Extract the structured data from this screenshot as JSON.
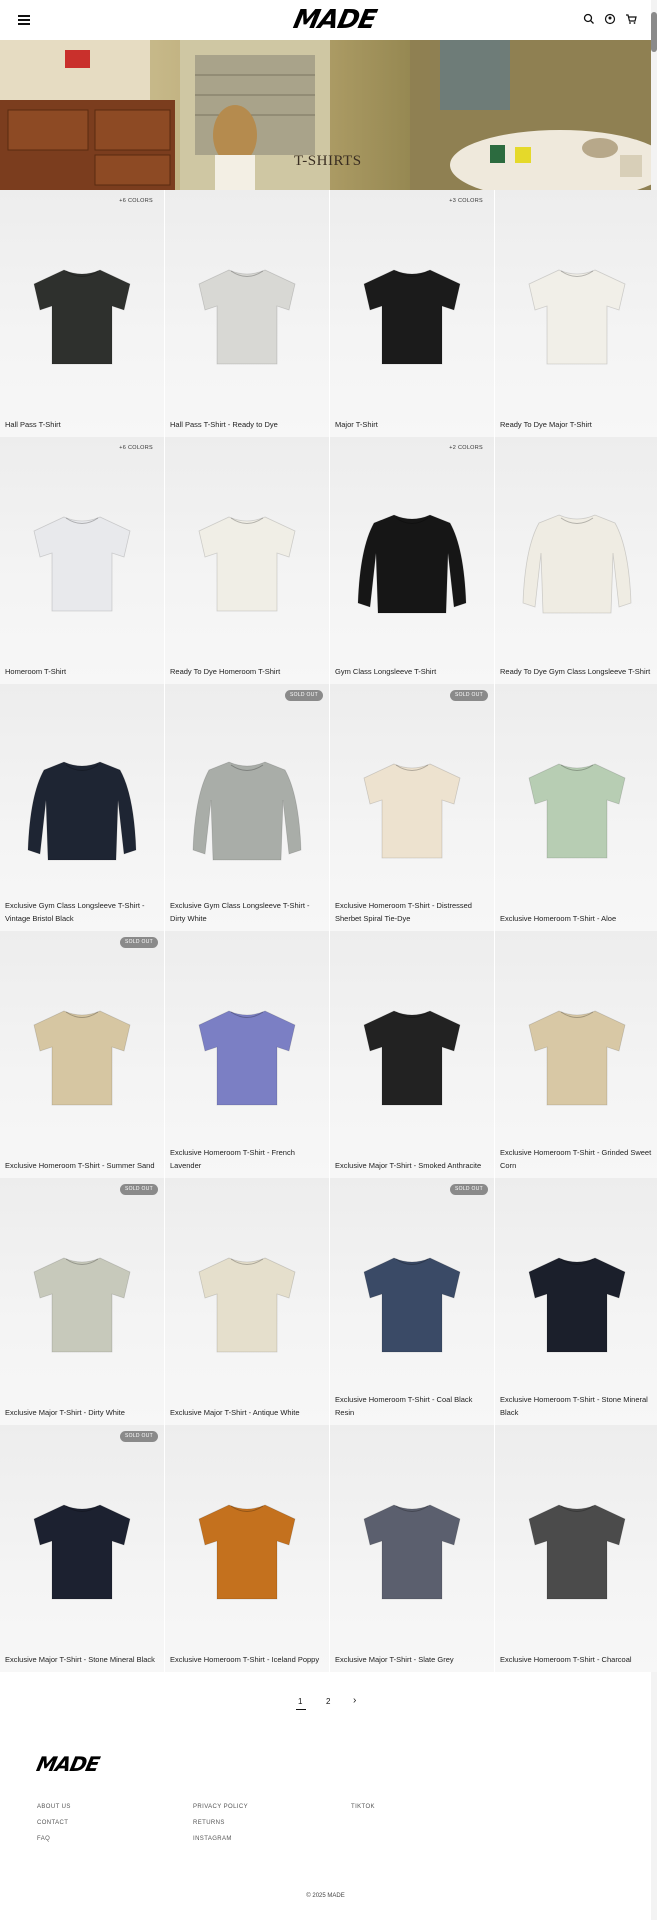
{
  "header": {
    "logo": "MADE",
    "icons": [
      "menu-icon",
      "search-icon",
      "account-icon",
      "cart-icon"
    ]
  },
  "hero": {
    "title": "T-SHIRTS"
  },
  "products": [
    {
      "title": "Hall Pass T-Shirt",
      "badge": "+6 COLORS",
      "badge_style": "plain",
      "color": "#2e302d"
    },
    {
      "title": "Hall Pass T-Shirt - Ready to Dye",
      "badge": "",
      "badge_style": "",
      "color": "#d8d8d4"
    },
    {
      "title": "Major T-Shirt",
      "badge": "+3 COLORS",
      "badge_style": "plain",
      "color": "#1b1b1b"
    },
    {
      "title": "Ready To Dye Major T-Shirt",
      "badge": "",
      "badge_style": "",
      "color": "#f1efe8"
    },
    {
      "title": "Homeroom T-Shirt",
      "badge": "+6 COLORS",
      "badge_style": "plain",
      "color": "#e8e9ec"
    },
    {
      "title": "Ready To Dye Homeroom T-Shirt",
      "badge": "",
      "badge_style": "",
      "color": "#f0eee6"
    },
    {
      "title": "Gym Class Longsleeve T-Shirt",
      "badge": "+2 COLORS",
      "badge_style": "plain",
      "color": "#161616"
    },
    {
      "title": "Ready To Dye Gym Class Longsleeve T-Shirt",
      "badge": "",
      "badge_style": "",
      "color": "#efece3"
    },
    {
      "title": "Exclusive Gym Class Longsleeve T-Shirt - Vintage Bristol Black",
      "badge": "",
      "badge_style": "",
      "color": "#1e2533"
    },
    {
      "title": "Exclusive Gym Class Longsleeve T-Shirt - Dirty White",
      "badge": "SOLD OUT",
      "badge_style": "dark",
      "color": "#a9ada8"
    },
    {
      "title": "Exclusive Homeroom T-Shirt - Distressed Sherbet Spiral Tie-Dye",
      "badge": "SOLD OUT",
      "badge_style": "dark",
      "color": "#ede2cf"
    },
    {
      "title": "Exclusive Homeroom T-Shirt - Aloe",
      "badge": "",
      "badge_style": "",
      "color": "#b7cdb3"
    },
    {
      "title": "Exclusive Homeroom T-Shirt - Summer Sand",
      "badge": "SOLD OUT",
      "badge_style": "dark",
      "color": "#d6c6a2"
    },
    {
      "title": "Exclusive Homeroom T-Shirt - French Lavender",
      "badge": "",
      "badge_style": "",
      "color": "#7b7fc4"
    },
    {
      "title": "Exclusive Major T-Shirt - Smoked Anthracite",
      "badge": "",
      "badge_style": "",
      "color": "#222222"
    },
    {
      "title": "Exclusive Homeroom T-Shirt - Grinded Sweet Corn",
      "badge": "",
      "badge_style": "",
      "color": "#d8c8a5"
    },
    {
      "title": "Exclusive Major T-Shirt - Dirty White",
      "badge": "SOLD OUT",
      "badge_style": "dark",
      "color": "#c7c9bb"
    },
    {
      "title": "Exclusive Major T-Shirt - Antique White",
      "badge": "",
      "badge_style": "",
      "color": "#e5dfcc"
    },
    {
      "title": "Exclusive Homeroom T-Shirt - Coal Black Resin",
      "badge": "SOLD OUT",
      "badge_style": "dark",
      "color": "#3a4a66"
    },
    {
      "title": "Exclusive Homeroom T-Shirt - Stone Mineral Black",
      "badge": "",
      "badge_style": "",
      "color": "#1b1f2b"
    },
    {
      "title": "Exclusive Major T-Shirt - Stone Mineral Black",
      "badge": "SOLD OUT",
      "badge_style": "dark",
      "color": "#1c2130"
    },
    {
      "title": "Exclusive Homeroom T-Shirt - Iceland Poppy",
      "badge": "",
      "badge_style": "",
      "color": "#c4711e"
    },
    {
      "title": "Exclusive Major T-Shirt - Slate Grey",
      "badge": "",
      "badge_style": "",
      "color": "#5b5f6e"
    },
    {
      "title": "Exclusive Homeroom T-Shirt - Charcoal",
      "badge": "",
      "badge_style": "",
      "color": "#4b4b4b"
    }
  ],
  "pagination": {
    "pages": [
      "1",
      "2"
    ],
    "current": "1",
    "next": "›"
  },
  "footer": {
    "logo": "MADE",
    "links": [
      [
        "ABOUT US",
        "CONTACT",
        "FAQ"
      ],
      [
        "PRIVACY POLICY",
        "RETURNS",
        "INSTAGRAM"
      ],
      [
        "TIKTOK"
      ]
    ],
    "copyright": "© 2025 MADE"
  }
}
